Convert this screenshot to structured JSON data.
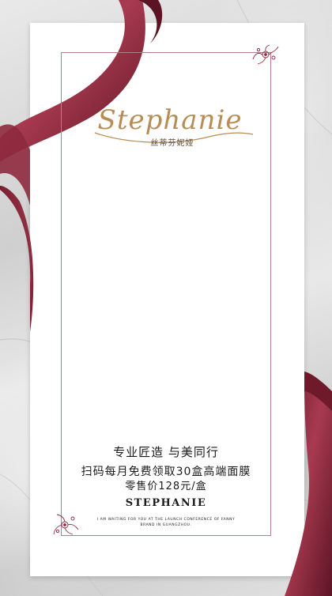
{
  "brand": {
    "script_name": "Stephanie",
    "chinese_name": "丝蒂芬妮娅"
  },
  "taglines": {
    "line1": "专业匠造  与美同行",
    "line2": "扫码每月免费领取30盒高端面膜",
    "line3": "零售价128元/盒"
  },
  "footer": {
    "brand_caps": "STEPHANIE",
    "fine_line1": "I AM WAITING FOR YOU AT THE LAUNCH CONFERENCE OF FANNY",
    "fine_line2": "BRAND IN GUANGZHOU."
  },
  "colors": {
    "ribbon": "#8e2a3e",
    "gold": "#b98c55",
    "frame": "#b27f88",
    "card": "#ffffff"
  }
}
